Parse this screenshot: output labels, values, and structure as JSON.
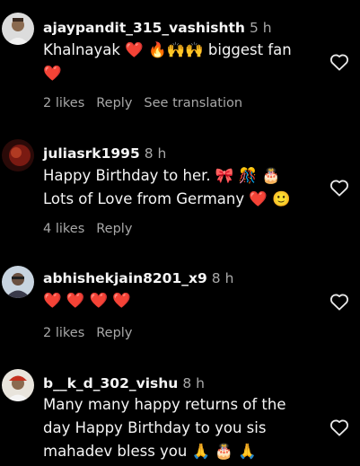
{
  "comments": [
    {
      "username": "ajaypandit_315_vashishth",
      "time": "5 h",
      "text": "Khalnayak ❤️ 🔥🙌🙌 biggest fan\n❤️",
      "likes": "2 likes",
      "reply": "Reply",
      "translation": "See translation"
    },
    {
      "username": "juliasrk1995",
      "time": "8 h",
      "text": "Happy Birthday to her. 🎀 🎊 🎂\nLots of Love from Germany ❤️ 🙂",
      "likes": "4 likes",
      "reply": "Reply"
    },
    {
      "username": "abhishekjain8201_x9",
      "time": "8 h",
      "text": "❤️ ❤️ ❤️ ❤️",
      "likes": "2 likes",
      "reply": "Reply"
    },
    {
      "username": "b__k_d_302_vishu",
      "time": "8 h",
      "text": "Many many happy returns of the\nday Happy Birthday to you sis\nmahadev bless you 🙏 🎂 🙏"
    }
  ],
  "icons": {
    "like": "heart-outline-icon",
    "avatar": "user-avatar"
  },
  "colors": {
    "background": "#000000",
    "primary_text": "#f5f5f5",
    "secondary_text": "#a8a8a8"
  }
}
